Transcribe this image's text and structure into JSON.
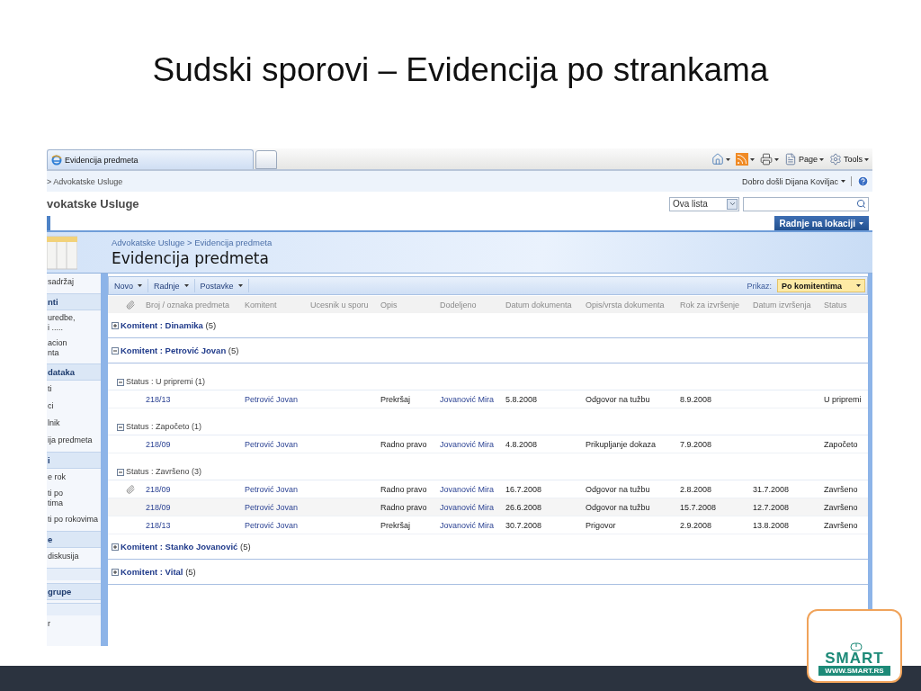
{
  "slide": {
    "title": "Sudski sporovi – Evidencija po strankama",
    "logo": {
      "name": "SMART",
      "url": "WWW.SMART.RS"
    }
  },
  "browser": {
    "tab": "Evidencija predmeta",
    "commands": [
      {
        "kind": "home"
      },
      {
        "kind": "feed"
      },
      {
        "kind": "print"
      },
      {
        "kind": "page",
        "label": "Page"
      },
      {
        "kind": "tools",
        "label": "Tools"
      }
    ]
  },
  "site": {
    "breadcrumb": "> Advokatske Usluge",
    "welcome": "Dobro došli Dijana Koviljac",
    "title": "vokatske Usluge",
    "search_scope": "Ova lista",
    "site_actions": "Radnje na lokaciji",
    "page_breadcrumb": "Advokatske Usluge > Evidencija predmeta",
    "page_title": "Evidencija predmeta"
  },
  "sidebar": [
    {
      "kind": "item",
      "label": "sadržaj"
    },
    {
      "kind": "header",
      "label": "nti"
    },
    {
      "kind": "item",
      "label": "uredbe,\ni ....."
    },
    {
      "kind": "item",
      "label": "acion\nnta"
    },
    {
      "kind": "header",
      "label": "dataka"
    },
    {
      "kind": "item",
      "label": "ti"
    },
    {
      "kind": "item",
      "label": "ci"
    },
    {
      "kind": "item",
      "label": "lnik"
    },
    {
      "kind": "item",
      "label": "ija predmeta"
    },
    {
      "kind": "header",
      "label": "i"
    },
    {
      "kind": "item",
      "label": "e rok"
    },
    {
      "kind": "item",
      "label": "ti po\ntima"
    },
    {
      "kind": "item",
      "label": "ti po rokovima"
    },
    {
      "kind": "header",
      "label": "e"
    },
    {
      "kind": "item",
      "label": "diskusija"
    },
    {
      "kind": "spacer"
    },
    {
      "kind": "header",
      "label": "grupe"
    },
    {
      "kind": "spacer"
    },
    {
      "kind": "item",
      "label": "r"
    }
  ],
  "list_toolbar": [
    "Novo",
    "Radnje",
    "Postavke"
  ],
  "view": {
    "label": "Prikaz:",
    "value": "Po komitentima"
  },
  "columns": [
    "Broj / oznaka predmeta",
    "Komitent",
    "Ucesnik u sporu",
    "Opis",
    "Dodeljeno",
    "Datum dokumenta",
    "Opis/vrsta dokumenta",
    "Rok za izvršenje",
    "Datum izvršenja",
    "Status"
  ],
  "groups": [
    {
      "label": "**Komitent : Dinamika** (5)",
      "expanded": false
    },
    {
      "label": "**Komitent : Petrović Jovan** (5)",
      "expanded": true,
      "statuses": [
        {
          "label": "Status : U pripremi (1)",
          "expanded": true,
          "rows": [
            {
              "attachment": false,
              "broj": "218/13",
              "komitent": "Petrović Jovan",
              "opis": "Prekršaj",
              "dodeljeno": "Jovanović Mira",
              "datum": "5.8.2008",
              "vrsta": "Odgovor na tužbu",
              "rok": "8.9.2008",
              "status": "U pripremi"
            }
          ]
        },
        {
          "label": "Status : Započeto (1)",
          "expanded": true,
          "rows": [
            {
              "attachment": false,
              "broj": "218/09",
              "komitent": "Petrović Jovan",
              "opis": "Radno pravo",
              "dodeljeno": "Jovanović Mira",
              "datum": "4.8.2008",
              "vrsta": "Prikupljanje dokaza",
              "rok": "7.9.2008",
              "status": "Započeto"
            }
          ]
        },
        {
          "label": "Status : Završeno (3)",
          "expanded": true,
          "rows": [
            {
              "attachment": true,
              "broj": "218/09",
              "komitent": "Petrović Jovan",
              "opis": "Radno pravo",
              "dodeljeno": "Jovanović Mira",
              "datum": "16.7.2008",
              "vrsta": "Odgovor na tužbu",
              "rok": "2.8.2008",
              "izvrseno": "31.7.2008",
              "status": "Završeno"
            },
            {
              "attachment": false,
              "broj": "218/09",
              "komitent": "Petrović Jovan",
              "opis": "Radno pravo",
              "dodeljeno": "Jovanović Mira",
              "datum": "26.6.2008",
              "vrsta": "Odgovor na tužbu",
              "rok": "15.7.2008",
              "izvrseno": "12.7.2008",
              "status": "Završeno"
            },
            {
              "attachment": false,
              "broj": "218/13",
              "komitent": "Petrović Jovan",
              "opis": "Prekršaj",
              "dodeljeno": "Jovanović Mira",
              "datum": "30.7.2008",
              "vrsta": "Prigovor",
              "rok": "2.9.2008",
              "izvrseno": "13.8.2008",
              "status": "Završeno"
            }
          ]
        }
      ]
    },
    {
      "label": "**Komitent : Stanko Jovanović** (5)",
      "expanded": false
    },
    {
      "label": "**Komitent : Vital** (5)",
      "expanded": false
    }
  ]
}
